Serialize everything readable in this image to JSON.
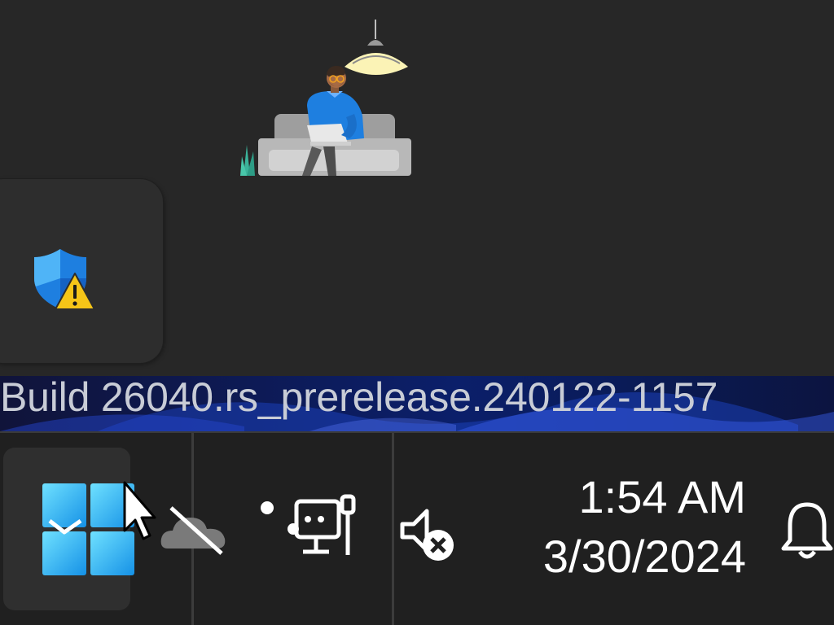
{
  "desktop": {
    "build_watermark": "Build 26040.rs_prerelease.240122-1157"
  },
  "security_notice": {
    "icon": "windows-security-warning-icon"
  },
  "taskbar": {
    "start_icon": "windows-start-icon",
    "tray": {
      "onedrive_icon": "onedrive-offline-icon",
      "overflow_icon": "tray-overflow-dots-icon",
      "network_icon": "ethernet-disconnected-icon",
      "volume_icon": "volume-muted-icon"
    },
    "clock": {
      "time": "1:54 AM",
      "date": "3/30/2024"
    },
    "notifications_icon": "bell-icon"
  },
  "colors": {
    "accent_blue": "#1e7fe0",
    "warning_yellow": "#f5c518",
    "taskbar_bg": "#202020"
  }
}
